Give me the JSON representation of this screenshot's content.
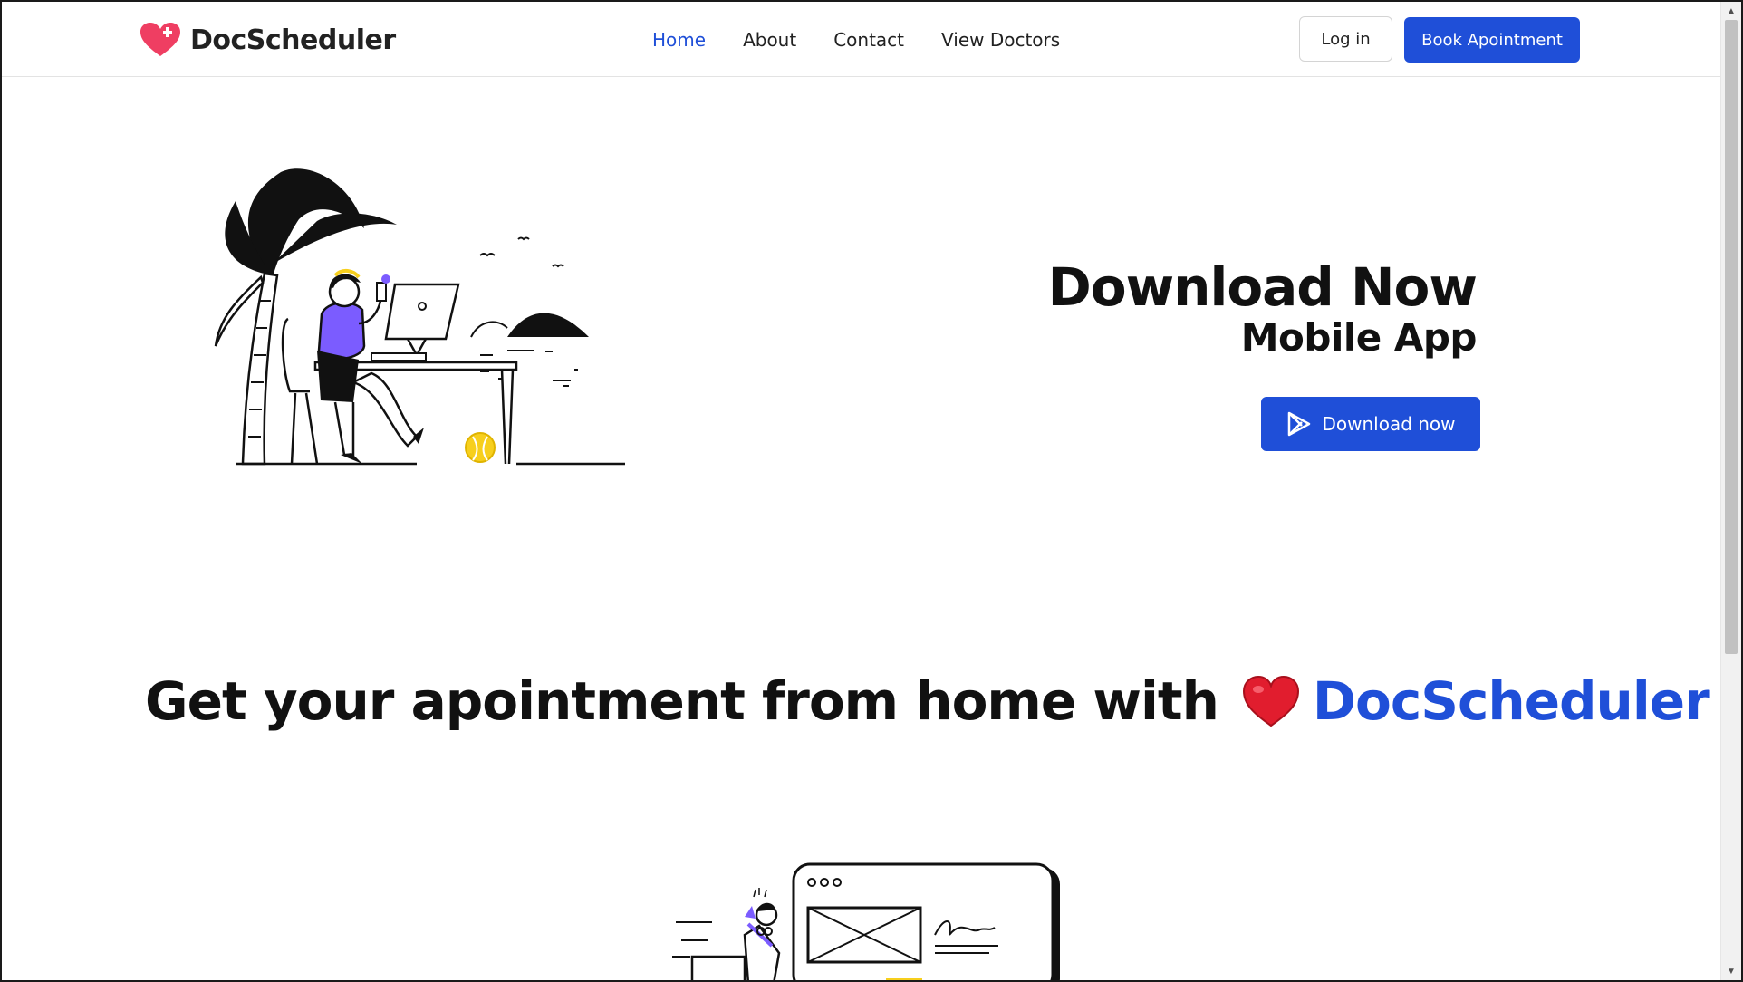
{
  "brand": {
    "name": "DocScheduler",
    "icon": "heart-plus-icon",
    "color": "#ef3e62"
  },
  "nav": {
    "items": [
      {
        "label": "Home",
        "active": true
      },
      {
        "label": "About",
        "active": false
      },
      {
        "label": "Contact",
        "active": false
      },
      {
        "label": "View Doctors",
        "active": false
      }
    ],
    "login_label": "Log in",
    "book_label": "Book Apointment"
  },
  "hero": {
    "title": "Download Now",
    "subtitle": "Mobile App",
    "download_label": "Download now",
    "download_icon": "play-store-icon"
  },
  "tagline": {
    "prefix": "Get your apointment from home with",
    "heart_icon": "red-heart-icon",
    "brand": "DocScheduler"
  },
  "colors": {
    "accent": "#1f4fd8",
    "text": "#111111",
    "heart": "#e11d2e",
    "illustration_purple": "#7b5cff",
    "illustration_yellow": "#f7cf1d"
  }
}
